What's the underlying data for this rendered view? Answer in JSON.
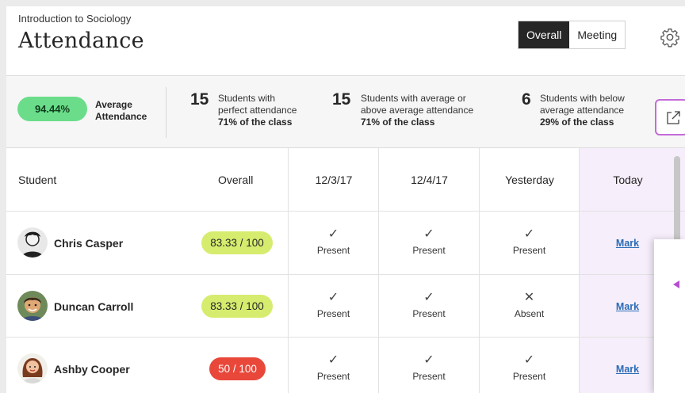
{
  "header": {
    "course": "Introduction to Sociology",
    "title": "Attendance",
    "view_toggle": [
      "Overall",
      "Meeting"
    ],
    "active_view": "Overall",
    "settings_icon": "gear-icon"
  },
  "summary": {
    "average_value": "94.44%",
    "average_label": "Average Attendance",
    "stats": [
      {
        "number": "15",
        "text": "Students with perfect attendance",
        "pct": "71% of the class"
      },
      {
        "number": "15",
        "text": "Students with average or above average attendance",
        "pct": "71% of the class"
      },
      {
        "number": "6",
        "text": "Students with below average attendance",
        "pct": "29% of the class"
      }
    ],
    "export_icon": "external-link-icon"
  },
  "table": {
    "columns": [
      "Student",
      "Overall",
      "12/3/17",
      "12/4/17",
      "Yesterday",
      "Today"
    ],
    "rows": [
      {
        "name": "Chris Casper",
        "grade": "83.33 / 100",
        "grade_color": "#d6ec6e",
        "cells": [
          {
            "icon": "check-icon",
            "status": "Present"
          },
          {
            "icon": "check-icon",
            "status": "Present"
          },
          {
            "icon": "check-icon",
            "status": "Present"
          }
        ],
        "today": "Mark"
      },
      {
        "name": "Duncan Carroll",
        "grade": "83.33 / 100",
        "grade_color": "#d6ec6e",
        "cells": [
          {
            "icon": "check-icon",
            "status": "Present"
          },
          {
            "icon": "check-icon",
            "status": "Present"
          },
          {
            "icon": "cross-icon",
            "status": "Absent"
          }
        ],
        "today": "Mark"
      },
      {
        "name": "Ashby Cooper",
        "grade": "50 / 100",
        "grade_color": "#e8473a",
        "cells": [
          {
            "icon": "check-icon",
            "status": "Present"
          },
          {
            "icon": "check-icon",
            "status": "Present"
          },
          {
            "icon": "check-icon",
            "status": "Present"
          }
        ],
        "today": "Mark"
      }
    ]
  },
  "colors": {
    "accent": "#c36bd8",
    "average_pill": "#6bdd8a",
    "today_column": "#f6eefb",
    "link": "#2b6cb7"
  }
}
